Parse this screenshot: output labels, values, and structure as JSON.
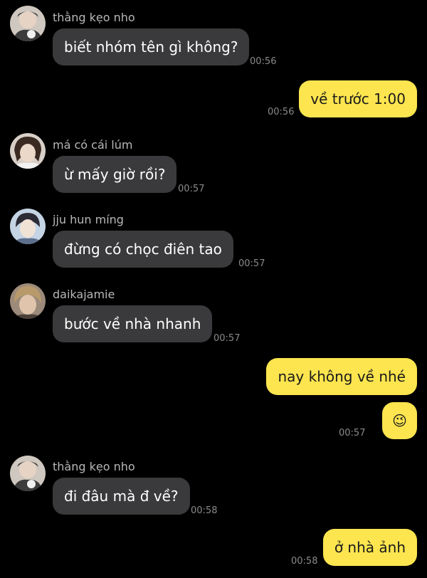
{
  "colors": {
    "background": "#000000",
    "incoming_bubble": "#3a3a3c",
    "outgoing_bubble": "#fde54f",
    "sender_name": "#b8b8b8",
    "timestamp": "#8a8a8a"
  },
  "messages": [
    {
      "direction": "incoming",
      "sender": "thằng kẹo nho",
      "text": "biết nhóm tên gì không?",
      "time": "00:56"
    },
    {
      "direction": "outgoing",
      "text": "về trước 1:00",
      "time": "00:56"
    },
    {
      "direction": "incoming",
      "sender": "má có cái lúm",
      "text": "ừ mấy giờ rồi?",
      "time": "00:57"
    },
    {
      "direction": "incoming",
      "sender": "jju hun míng",
      "text": "đừng có chọc điên tao",
      "time": "00:57"
    },
    {
      "direction": "incoming",
      "sender": "daikajamie",
      "text": "bước về nhà nhanh",
      "time": "00:57"
    },
    {
      "direction": "outgoing",
      "text": "nay không về nhé",
      "time": ""
    },
    {
      "direction": "outgoing",
      "text": "😉",
      "icon": "wink-emoji",
      "time": "00:57"
    },
    {
      "direction": "incoming",
      "sender": "thằng kẹo nho",
      "text": "đi đâu mà đ về?",
      "time": "00:58"
    },
    {
      "direction": "outgoing",
      "text": "ở nhà ảnh",
      "time": "00:58"
    }
  ]
}
